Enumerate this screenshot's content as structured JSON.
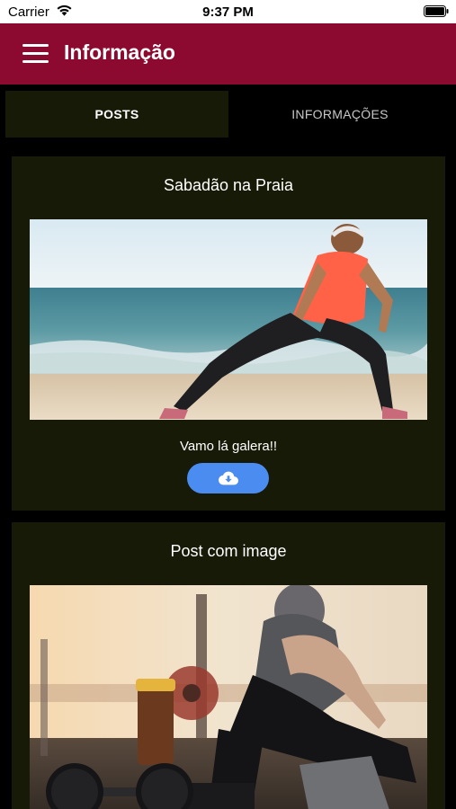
{
  "status_bar": {
    "carrier": "Carrier",
    "time": "9:37 PM"
  },
  "app_bar": {
    "title": "Informação",
    "menu_icon": "hamburger-menu-icon",
    "background": "#8c0a2f"
  },
  "tabs": [
    {
      "label": "POSTS",
      "selected": true
    },
    {
      "label": "INFORMAÇÕES",
      "selected": false
    }
  ],
  "posts": [
    {
      "title": "Sabadão na Praia",
      "image": "woman stretching on beach",
      "text": "Vamo lá galera!!",
      "action_icon": "cloud-download-icon"
    },
    {
      "title": "Post com image",
      "image": "woman resting in gym with dumbbells and water bottle"
    }
  ],
  "colors": {
    "card_background": "#181a08",
    "button": "#4b8cf0"
  }
}
